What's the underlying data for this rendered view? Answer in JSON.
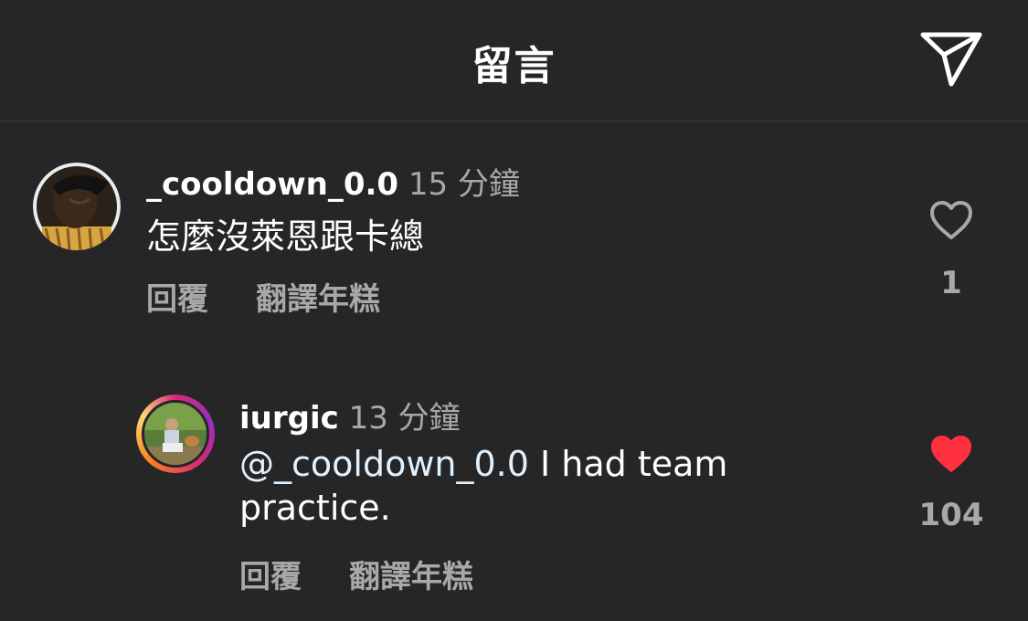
{
  "header": {
    "title": "留言",
    "share_icon": "paper-plane-icon"
  },
  "comments": [
    {
      "username": "_cooldown_0.0",
      "time": "15 分鐘",
      "text": "怎麼沒萊恩跟卡總",
      "reply_label": "回覆",
      "translate_label": "翻譯年糕",
      "likes": "1",
      "liked": false,
      "like_icon": "heart-outline-icon"
    },
    {
      "username": "iurgic",
      "time": "13 分鐘",
      "mention": "@_cooldown_0.0",
      "text": " I had team practice.",
      "reply_label": "回覆",
      "translate_label": "翻譯年糕",
      "likes": "104",
      "liked": true,
      "like_icon": "heart-filled-icon",
      "like_color": "#ff3040"
    }
  ],
  "colors": {
    "background": "#262626",
    "text_primary": "#ffffff",
    "text_secondary": "#a8a8a8",
    "like_red": "#ff3040"
  }
}
